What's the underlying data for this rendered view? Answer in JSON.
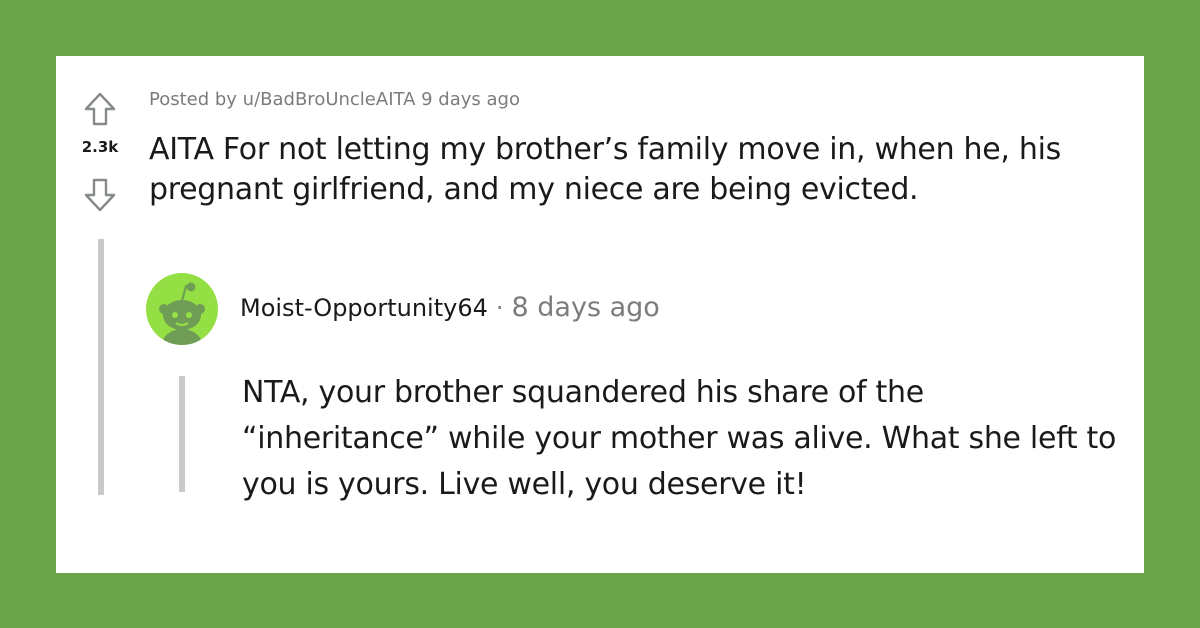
{
  "post": {
    "score": "2.3k",
    "meta": "Posted by u/BadBroUncleAITA 9 days ago",
    "title": "AITA For not letting my brother’s family move in, when he, his pregnant girlfriend, and my niece are being evicted."
  },
  "comment": {
    "author": "Moist-Opportunity64",
    "separator": "·",
    "time": "8 days ago",
    "body": "NTA, your brother squandered his share of the “inheritance” while your mother was alive. What she left to you is yours. Live well, you deserve it!"
  },
  "icons": {
    "upvote": "upvote-arrow-icon",
    "downvote": "downvote-arrow-icon",
    "avatar": "snoo-avatar-icon"
  },
  "colors": {
    "background": "#6ca54c",
    "card": "#ffffff",
    "text": "#1a1a1b",
    "meta": "#7c7c7c",
    "thread_line": "#c9c9c9",
    "avatar_bg": "#94e044"
  }
}
